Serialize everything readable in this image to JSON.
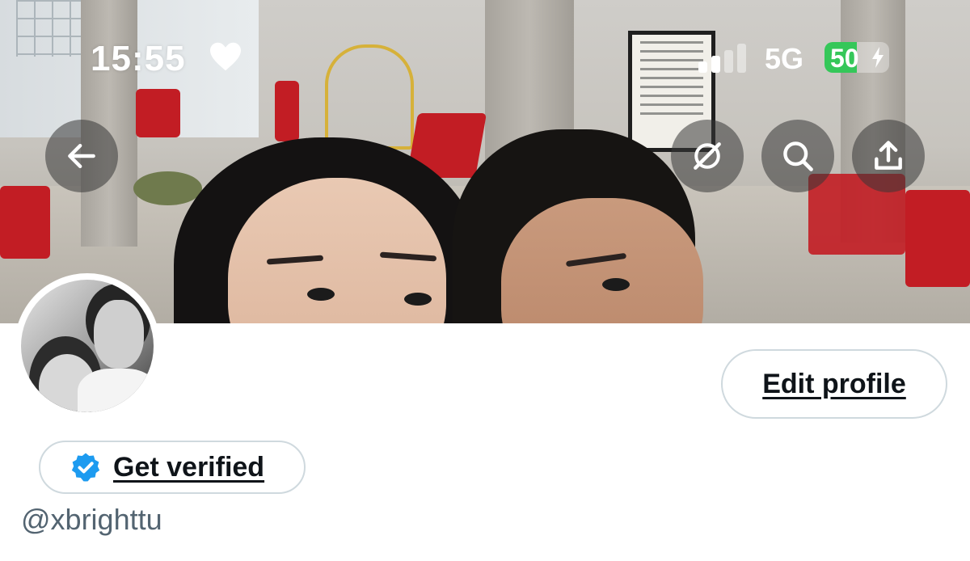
{
  "status_bar": {
    "time": "15:55",
    "network": "5G",
    "battery_level": "50",
    "battery_percent": 50,
    "battery_color": "#35c759",
    "icons": [
      "heart-icon",
      "signal-icon",
      "battery-icon",
      "charging-bolt-icon"
    ]
  },
  "header": {
    "buttons": [
      {
        "name": "back-button",
        "icon": "arrow-left-icon"
      },
      {
        "name": "grok-button",
        "icon": "grok-icon"
      },
      {
        "name": "search-button",
        "icon": "search-icon"
      },
      {
        "name": "share-button",
        "icon": "share-icon"
      }
    ]
  },
  "profile": {
    "edit_label": "Edit profile",
    "verified_label": "Get verified",
    "handle": "@xbrighttu",
    "badge_color": "#1d9bf0"
  }
}
